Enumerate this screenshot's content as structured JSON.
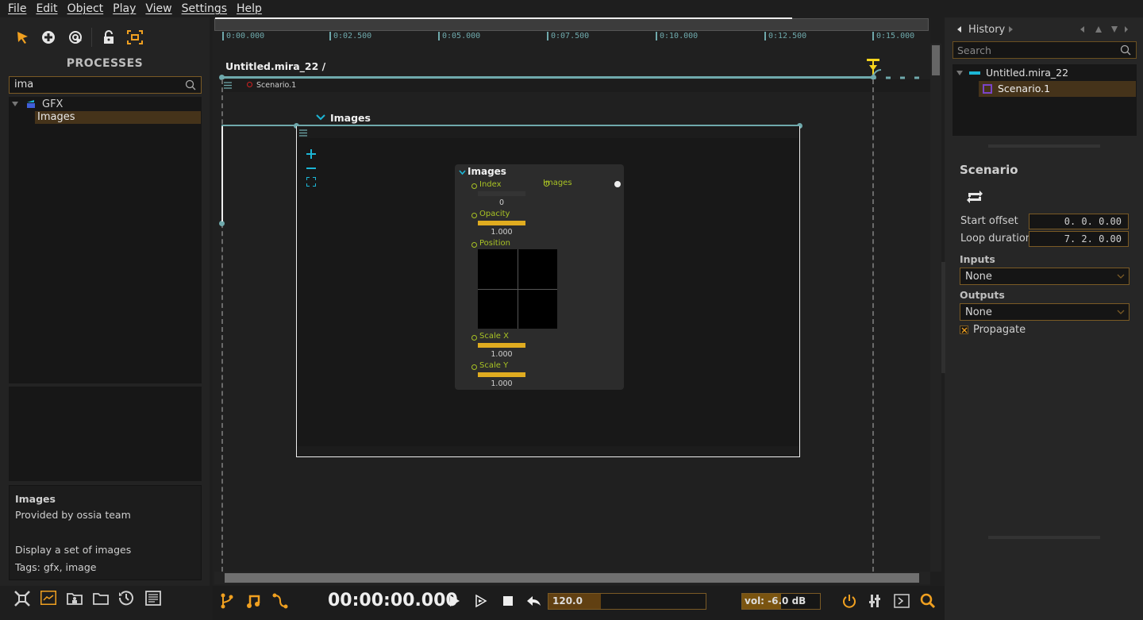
{
  "menu": [
    "File",
    "Edit",
    "Object",
    "Play",
    "View",
    "Settings",
    "Help"
  ],
  "processes": {
    "title": "PROCESSES",
    "search_value": "ima",
    "tree": [
      {
        "label": "GFX",
        "children": [
          {
            "label": "Images",
            "selected": true
          }
        ]
      }
    ],
    "info": {
      "name": "Images",
      "provider": "Provided by ossia team",
      "description": "Display a set of images",
      "tags": "Tags: gfx, image"
    }
  },
  "timeline": {
    "ticks": [
      "0:00.000",
      "0:02.500",
      "0:05.000",
      "0:07.500",
      "0:10.000",
      "0:12.500",
      "0:15.000"
    ],
    "document_title": "Untitled.mira_22 /",
    "scenario_label": "Scenario.1",
    "process_label": "Images"
  },
  "node": {
    "title": "Images",
    "output_label": "Images",
    "ports": [
      {
        "label": "Index",
        "value": "0",
        "fraction": 0
      },
      {
        "label": "Opacity",
        "value": "1.000",
        "fraction": 1
      },
      {
        "label": "Position",
        "type": "xy"
      },
      {
        "label": "Scale X",
        "value": "1.000",
        "fraction": 1
      },
      {
        "label": "Scale Y",
        "value": "1.000",
        "fraction": 1
      }
    ]
  },
  "history": {
    "title": "History",
    "search_placeholder": "Search",
    "tree": [
      {
        "label": "Untitled.mira_22",
        "children": [
          {
            "label": "Scenario.1",
            "selected": true
          }
        ]
      }
    ]
  },
  "inspector": {
    "title": "Scenario",
    "start_offset_label": "Start offset",
    "start_offset_value": "0. 0. 0.00",
    "loop_duration_label": "Loop duration",
    "loop_duration_value": "7. 2. 0.00",
    "inputs_label": "Inputs",
    "inputs_value": "None",
    "outputs_label": "Outputs",
    "outputs_value": "None",
    "propagate_label": "Propagate",
    "propagate_checked": true
  },
  "transport": {
    "time": "00:00:00.000",
    "tempo": "120.0",
    "volume": "vol: -6.0 dB",
    "volume_fraction": 0.5
  },
  "colors": {
    "accent": "#f0a020",
    "teal": "#6fa9ac",
    "cyan": "#1cb6d6",
    "port": "#a8c224"
  }
}
